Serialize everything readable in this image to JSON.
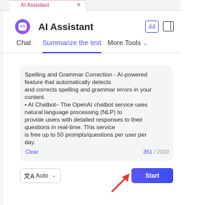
{
  "tab": {
    "title": "AI Assistant",
    "close": "×"
  },
  "header": {
    "title": "AI Assistant",
    "counter": "44",
    "logo_icon": "robot-face-icon",
    "panel_icon": "sidebar-panel-icon"
  },
  "nav": {
    "chat": "Chat",
    "summarize": "Summarize the text",
    "more": "More Tools",
    "more_chevron": "⌄"
  },
  "editor": {
    "text": "Spelling and Grammar Correction - AI-powered\nfeature that automatically detects\nand corrects spelling and grammar errors in your\ncontent.\n• AI Chatbot– The OpenAI chatbot service uses\nnatural language processing (NLP) to\nprovide users with detailed responses to their\nquestions in real-time. This service\nis free up to 50 prompts/questions per user per\nday.",
    "clear_label": "Clear",
    "char_used": "361",
    "char_limit": " / 2000"
  },
  "language": {
    "icon": "文A",
    "value": "Auto",
    "chevron": "⌄"
  },
  "start_label": "Start",
  "colors": {
    "accent": "#4a55e0",
    "arrow": "#e53935",
    "tab_accent": "#c12d6f"
  }
}
